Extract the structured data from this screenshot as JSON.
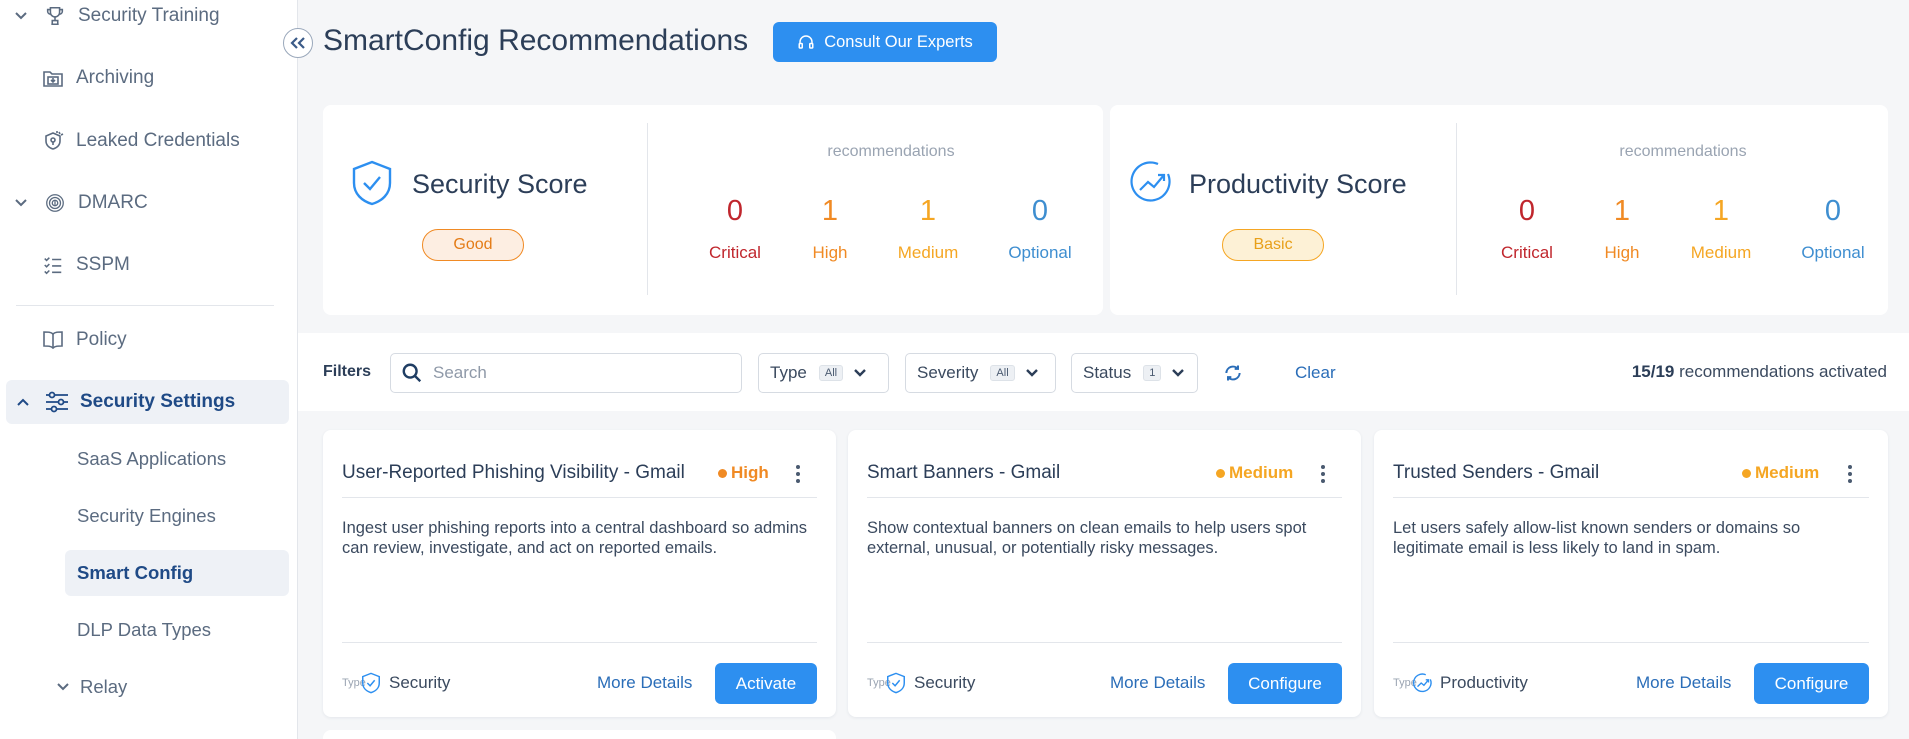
{
  "sidebar": {
    "items": [
      {
        "label": "Security Training",
        "icon": "trophy-icon",
        "chevron": "down"
      },
      {
        "label": "Archiving",
        "icon": "archive-icon"
      },
      {
        "label": "Leaked Credentials",
        "icon": "leaked-credentials-icon"
      },
      {
        "label": "DMARC",
        "icon": "fingerprint-icon",
        "chevron": "down"
      },
      {
        "label": "SSPM",
        "icon": "checklist-icon"
      },
      {
        "label": "Policy",
        "icon": "book-icon"
      },
      {
        "label": "Security Settings",
        "icon": "sliders-icon",
        "chevron": "up",
        "active": true
      }
    ],
    "sub_items": [
      {
        "label": "SaaS Applications"
      },
      {
        "label": "Security Engines"
      },
      {
        "label": "Smart Config",
        "selected": true
      },
      {
        "label": "DLP Data Types"
      },
      {
        "label": "Relay",
        "chevron": "down"
      }
    ]
  },
  "header": {
    "title": "SmartConfig Recommendations",
    "consult_button": "Consult Our Experts"
  },
  "security_score": {
    "title": "Security Score",
    "badge": "Good",
    "recs_label": "recommendations",
    "counts": [
      {
        "value": "0",
        "label": "Critical",
        "color": "#c0262d"
      },
      {
        "value": "1",
        "label": "High",
        "color": "#f08a24"
      },
      {
        "value": "1",
        "label": "Medium",
        "color": "#f5a623"
      },
      {
        "value": "0",
        "label": "Optional",
        "color": "#3e8ed0"
      }
    ]
  },
  "productivity_score": {
    "title": "Productivity Score",
    "badge": "Basic",
    "recs_label": "recommendations",
    "counts": [
      {
        "value": "0",
        "label": "Critical",
        "color": "#c0262d"
      },
      {
        "value": "1",
        "label": "High",
        "color": "#f08a24"
      },
      {
        "value": "1",
        "label": "Medium",
        "color": "#f5a623"
      },
      {
        "value": "0",
        "label": "Optional",
        "color": "#3e8ed0"
      }
    ]
  },
  "filters": {
    "label": "Filters",
    "search_placeholder": "Search",
    "type": {
      "label": "Type",
      "value": "All"
    },
    "severity": {
      "label": "Severity",
      "value": "All"
    },
    "status": {
      "label": "Status",
      "value": "1"
    },
    "clear": "Clear",
    "activated_count": "15/19",
    "activated_text": "recommendations activated"
  },
  "cards": [
    {
      "title": "User-Reported Phishing Visibility - Gmail",
      "severity": "High",
      "severity_color": "#f08a24",
      "description": "Ingest user phishing reports into a central dashboard so admins can review, investigate, and act on reported emails.",
      "type_label": "Type",
      "type": "Security",
      "more": "More Details",
      "action": "Activate"
    },
    {
      "title": "Smart Banners - Gmail",
      "severity": "Medium",
      "severity_color": "#f5a623",
      "description": "Show contextual banners on clean emails to help users spot external, unusual, or potentially risky messages.",
      "type_label": "Type",
      "type": "Security",
      "more": "More Details",
      "action": "Configure"
    },
    {
      "title": "Trusted Senders - Gmail",
      "severity": "Medium",
      "severity_color": "#f5a623",
      "description": "Let users safely allow-list known senders or domains so legitimate email is less likely to land in spam.",
      "type_label": "Type",
      "type": "Productivity",
      "more": "More Details",
      "action": "Configure"
    }
  ],
  "colors": {
    "accent": "#2d8ff0",
    "link": "#2a6db8",
    "good_badge_bg": "#fdeee2",
    "good_badge_border": "#f08a24",
    "basic_badge_bg": "#fdf1d6",
    "basic_badge_border": "#f5a623"
  }
}
